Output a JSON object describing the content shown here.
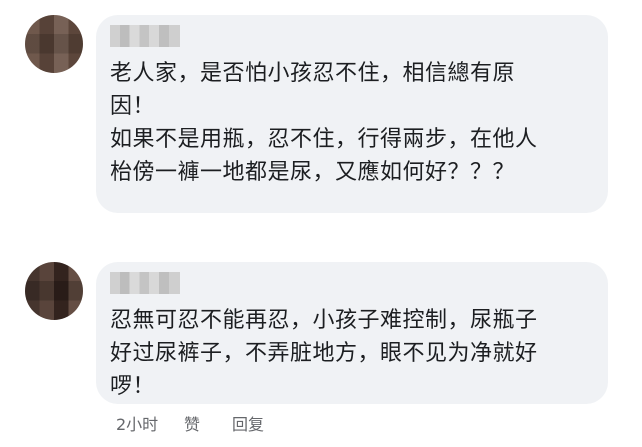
{
  "comments": [
    {
      "text": "老人家，是否怕小孩忍不住，相信總有原\n因！\n如果不是用瓶，忍不住，行得兩步，在他人\n枱傍一褲一地都是尿，又應如何好？？？"
    },
    {
      "text": "忍無可忍不能再忍，小孩子难控制，尿瓶子\n好过尿裤子，不弄脏地方，眼不见为净就好\n啰！"
    }
  ],
  "actions": {
    "time": "2小时",
    "like": "赞",
    "reply": "回复"
  }
}
